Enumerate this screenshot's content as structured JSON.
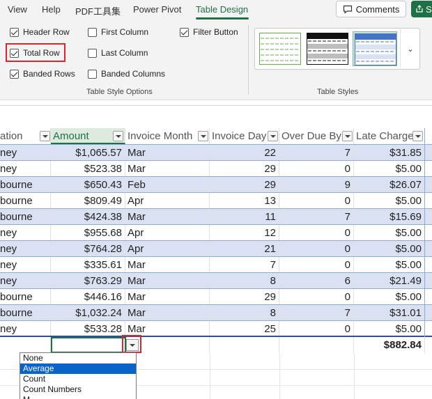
{
  "ribbon_tabs": [
    "View",
    "Help",
    "PDF工具集",
    "Power Pivot",
    "Table Design"
  ],
  "active_tab": "Table Design",
  "comments_label": "Comments",
  "share_label": "S",
  "table_style_options": {
    "group_label": "Table Style Options",
    "header_row": {
      "label": "Header Row",
      "checked": true
    },
    "total_row": {
      "label": "Total Row",
      "checked": true
    },
    "banded_rows": {
      "label": "Banded Rows",
      "checked": true
    },
    "first_column": {
      "label": "First Column",
      "checked": false
    },
    "last_column": {
      "label": "Last Column",
      "checked": false
    },
    "banded_columns": {
      "label": "Banded Columns",
      "checked": false
    },
    "filter_button": {
      "label": "Filter Button",
      "checked": true
    }
  },
  "table_styles": {
    "group_label": "Table Styles",
    "colors": {
      "green": "#6aa84f",
      "black": "#111111",
      "blue": "#4472c4"
    }
  },
  "table": {
    "headers": [
      "ation",
      "Amount",
      "Invoice Month",
      "Invoice Day",
      "Over Due By",
      "Late Charge"
    ],
    "rows": [
      {
        "loc": "ney",
        "amount": "$1,065.57",
        "month": "Mar",
        "day": "22",
        "due": "7",
        "late": "$31.85"
      },
      {
        "loc": "ney",
        "amount": "$523.38",
        "month": "Mar",
        "day": "29",
        "due": "0",
        "late": "$5.00"
      },
      {
        "loc": "bourne",
        "amount": "$650.43",
        "month": "Feb",
        "day": "29",
        "due": "9",
        "late": "$26.07"
      },
      {
        "loc": "bourne",
        "amount": "$809.49",
        "month": "Apr",
        "day": "13",
        "due": "0",
        "late": "$5.00"
      },
      {
        "loc": "bourne",
        "amount": "$424.38",
        "month": "Mar",
        "day": "11",
        "due": "7",
        "late": "$15.69"
      },
      {
        "loc": "ney",
        "amount": "$955.68",
        "month": "Apr",
        "day": "12",
        "due": "0",
        "late": "$5.00"
      },
      {
        "loc": "ney",
        "amount": "$764.28",
        "month": "Apr",
        "day": "21",
        "due": "0",
        "late": "$5.00"
      },
      {
        "loc": "ney",
        "amount": "$335.61",
        "month": "Mar",
        "day": "7",
        "due": "0",
        "late": "$5.00"
      },
      {
        "loc": "ney",
        "amount": "$763.29",
        "month": "Mar",
        "day": "8",
        "due": "6",
        "late": "$21.49"
      },
      {
        "loc": "bourne",
        "amount": "$446.16",
        "month": "Mar",
        "day": "29",
        "due": "0",
        "late": "$5.00"
      },
      {
        "loc": "bourne",
        "amount": "$1,032.24",
        "month": "Mar",
        "day": "8",
        "due": "7",
        "late": "$31.01"
      },
      {
        "loc": "ney",
        "amount": "$533.28",
        "month": "Mar",
        "day": "25",
        "due": "0",
        "late": "$5.00"
      }
    ],
    "total_late_charge": "$882.84"
  },
  "total_function_options": [
    "None",
    "Average",
    "Count",
    "Count Numbers",
    "M"
  ],
  "selected_function": "Average"
}
